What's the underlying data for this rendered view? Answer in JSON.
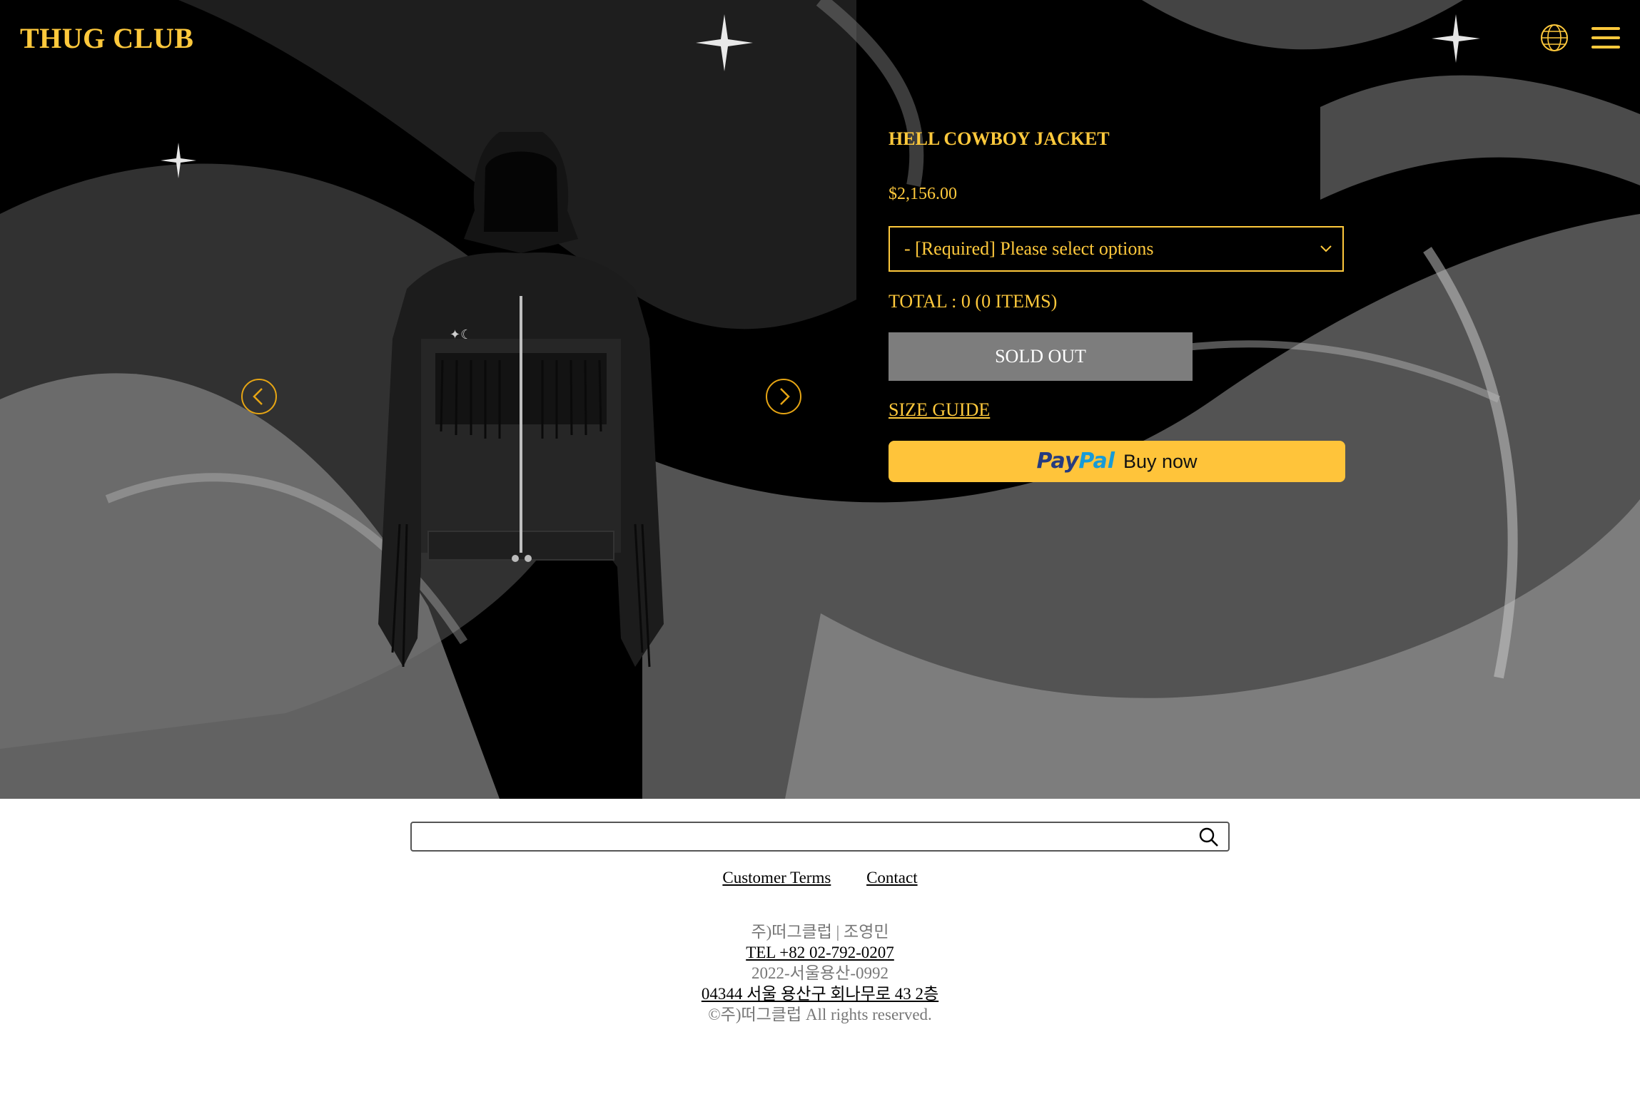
{
  "header": {
    "logo": "THUG CLUB",
    "globe_icon": "globe-icon",
    "menu_icon": "hamburger-menu-icon"
  },
  "product": {
    "title": "HELL COWBOY JACKET",
    "price": "$2,156.00",
    "option_select": "- [Required] Please select options",
    "total": "TOTAL : 0 (0 ITEMS)",
    "sold_out": "SOLD OUT",
    "size_guide": "SIZE GUIDE",
    "paypal_brand_1": "Pay",
    "paypal_brand_2": "Pal",
    "paypal_action": "Buy now"
  },
  "gallery": {
    "prev_icon": "chevron-left-icon",
    "next_icon": "chevron-right-icon"
  },
  "footer": {
    "search_placeholder": "",
    "links": [
      "Customer Terms",
      "Contact"
    ],
    "company": "주)떠그클럽 | 조영민",
    "tel": "TEL +82 02-792-0207",
    "registration": "2022-서울용산-0992",
    "address": "04344 서울 용산구 회나무로 43 2층",
    "copyright": "©주)떠그클럽 All rights reserved."
  },
  "colors": {
    "accent": "#ffc93c",
    "sold_out_bg": "#7d7d7d",
    "paypal_bg": "#ffc43a"
  }
}
